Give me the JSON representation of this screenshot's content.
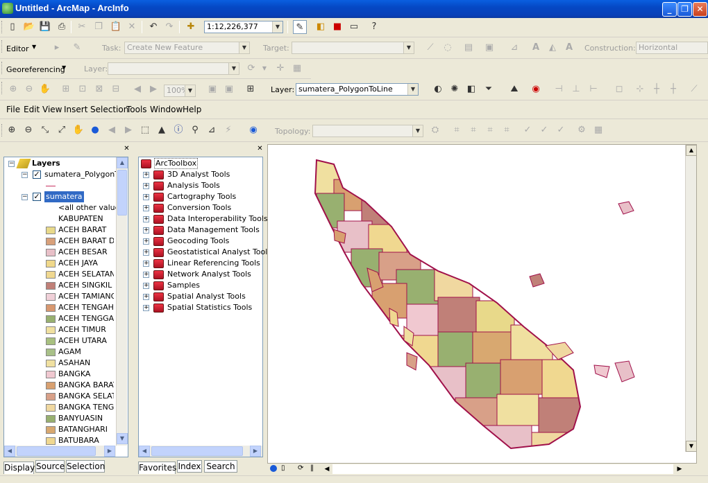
{
  "window": {
    "title": "Untitled - ArcMap - ArcInfo",
    "min": "_",
    "max": "❐",
    "close": "✕"
  },
  "standard_toolbar": {
    "scale": "1:12,226,377"
  },
  "editor_toolbar": {
    "editor_label": "Editor",
    "task_label": "Task:",
    "task_value": "Create New Feature",
    "target_label": "Target:",
    "construction_label": "Construction:",
    "construction_value": "Horizontal"
  },
  "georef_toolbar": {
    "label": "Georeferencing",
    "layer_label": "Layer:"
  },
  "layout_toolbar": {
    "zoom": "100%",
    "layer_label": "Layer:",
    "layer_value": "sumatera_PolygonToLine"
  },
  "menu": [
    "File",
    "Edit",
    "View",
    "Insert",
    "Selection",
    "Tools",
    "Window",
    "Help"
  ],
  "tools_toolbar": {
    "topology_label": "Topology:"
  },
  "toc": {
    "root": "Layers",
    "layer1": "sumatera_PolygonTo",
    "layer2": "sumatera",
    "other_values": "<all other values",
    "field": "KABUPATEN",
    "classes": [
      {
        "label": "ACEH BARAT",
        "color": "#e8d98a"
      },
      {
        "label": "ACEH BARAT DAY",
        "color": "#d8a07a"
      },
      {
        "label": "ACEH BESAR",
        "color": "#e8c0c8"
      },
      {
        "label": "ACEH JAYA",
        "color": "#f0d88a"
      },
      {
        "label": "ACEH SELATAN",
        "color": "#f0d890"
      },
      {
        "label": "ACEH SINGKIL",
        "color": "#c08078"
      },
      {
        "label": "ACEH TAMIANG",
        "color": "#f0d0d8"
      },
      {
        "label": "ACEH TENGAH",
        "color": "#d89870"
      },
      {
        "label": "ACEH TENGGARA",
        "color": "#98b070"
      },
      {
        "label": "ACEH TIMUR",
        "color": "#f0e0a0"
      },
      {
        "label": "ACEH UTARA",
        "color": "#a8c080"
      },
      {
        "label": "AGAM",
        "color": "#a8c088"
      },
      {
        "label": "ASAHAN",
        "color": "#f0e0a0"
      },
      {
        "label": "BANGKA",
        "color": "#f0c8d0"
      },
      {
        "label": "BANGKA BARAT",
        "color": "#d8a070"
      },
      {
        "label": "BANGKA SELATAN",
        "color": "#d8a088"
      },
      {
        "label": "BANGKA TENGAH",
        "color": "#f0d8a0"
      },
      {
        "label": "BANYUASIN",
        "color": "#98b070"
      },
      {
        "label": "BATANGHARI",
        "color": "#d8a870"
      },
      {
        "label": "BATUBARA",
        "color": "#f0d890"
      }
    ],
    "tabs": [
      "Display",
      "Source",
      "Selection"
    ]
  },
  "toolbox": {
    "root": "ArcToolbox",
    "items": [
      "3D Analyst Tools",
      "Analysis Tools",
      "Cartography Tools",
      "Conversion Tools",
      "Data Interoperability Tools",
      "Data Management Tools",
      "Geocoding Tools",
      "Geostatistical Analyst Tools",
      "Linear Referencing Tools",
      "Network Analyst Tools",
      "Samples",
      "Spatial Analyst Tools",
      "Spatial Statistics Tools"
    ],
    "tabs": [
      "Favorites",
      "Index",
      "Search"
    ]
  },
  "colors": {
    "title_bar": "#0a5fe0",
    "polygon_outline": "#a0104a"
  }
}
